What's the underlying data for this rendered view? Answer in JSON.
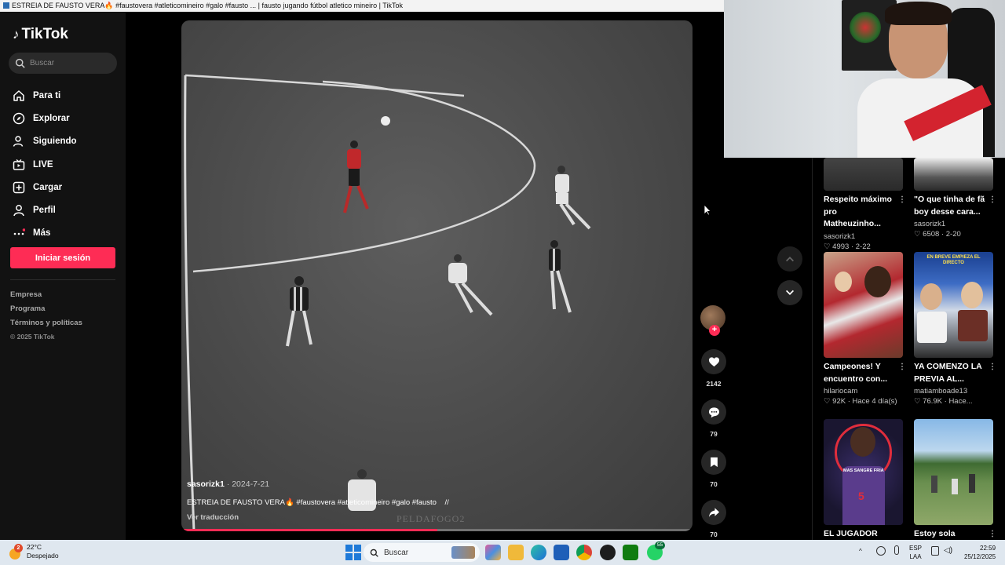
{
  "window": {
    "title": "ESTREIA DE FAUSTO VERA🔥 #faustovera #atleticomineiro #galo #fausto ... | fausto jugando fútbol atletico mineiro | TikTok"
  },
  "sidebar": {
    "logo": "TikTok",
    "search_placeholder": "Buscar",
    "nav": [
      {
        "label": "Para ti",
        "icon": "home-icon"
      },
      {
        "label": "Explorar",
        "icon": "compass-icon"
      },
      {
        "label": "Siguiendo",
        "icon": "following-icon"
      },
      {
        "label": "LIVE",
        "icon": "live-icon"
      },
      {
        "label": "Cargar",
        "icon": "upload-icon"
      },
      {
        "label": "Perfil",
        "icon": "profile-icon"
      },
      {
        "label": "Más",
        "icon": "more-icon"
      }
    ],
    "login_label": "Iniciar sesión",
    "footer": [
      "Empresa",
      "Programa",
      "Términos y políticas"
    ],
    "copyright": "© 2025 TikTok"
  },
  "video": {
    "author": "sasorizk1",
    "date": "· 2024-7-21",
    "caption": "ESTREIA DE FAUSTO VERA🔥 #faustovera #atleticomineiro #galo #fausto",
    "caption_suffix": "//",
    "translate_label": "Ver traducción",
    "watermark": "PELDAFOGO2",
    "progress": 0.5
  },
  "actions": {
    "likes": "2142",
    "comments": "79",
    "saves": "70",
    "shares": "70"
  },
  "recommended": [
    {
      "title": "Respeito máximo pro Matheuzinho...",
      "author": "sasorizk1",
      "likes": "4993",
      "date": "2-22"
    },
    {
      "title": "\"O que tinha de fã boy desse cara...",
      "author": "sasorizk1",
      "likes": "6508",
      "date": "2-20"
    },
    {
      "title": "Campeones! Y encuentro con...",
      "author": "hilariocam",
      "likes": "92K",
      "date": "Hace 4 día(s)"
    },
    {
      "title": "YA COMENZO LA PREVIA AL...",
      "author": "matiamboade13",
      "likes": "76.9K",
      "date": "Hace..."
    },
    {
      "title": "EL JUGADOR MAS",
      "author": "",
      "likes": "",
      "date": ""
    },
    {
      "title": "Estoy sola chicas,",
      "author": "",
      "likes": "",
      "date": ""
    }
  ],
  "thumb_texts": {
    "previa_banner": "EN BREVE EMPIEZA EL DIRECTO",
    "jersey_number": "5",
    "wolves_text": "MAS SANGRE FRIA"
  },
  "taskbar": {
    "temperature": "22°C",
    "condition": "Despejado",
    "search_label": "Buscar",
    "lang_top": "ESP",
    "lang_bottom": "LAA",
    "time": "22:59",
    "date": "25/12/2025",
    "whatsapp_badge": "55",
    "weather_badge": "2"
  }
}
